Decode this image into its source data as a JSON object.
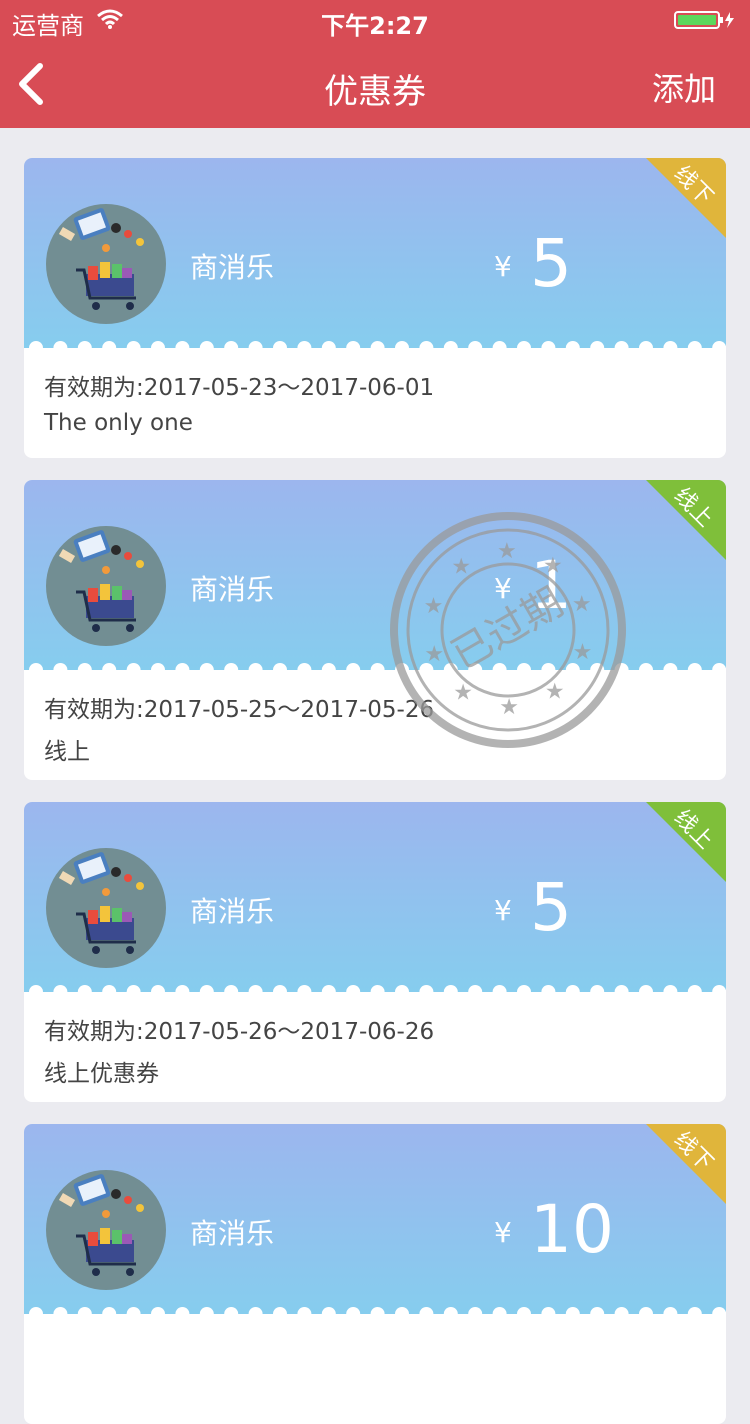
{
  "status": {
    "carrier": "运营商",
    "time": "下午2:27"
  },
  "nav": {
    "title": "优惠券",
    "add_label": "添加",
    "accent": "#d84c55"
  },
  "coupons": [
    {
      "brand": "商消乐",
      "currency": "¥",
      "amount": "5",
      "tag": "线下",
      "tag_color": "#e0b53b",
      "validity": "有效期为:2017-05-23～2017-06-01",
      "desc": "The only one",
      "expired": false
    },
    {
      "brand": "商消乐",
      "currency": "¥",
      "amount": "1",
      "tag": "线上",
      "tag_color": "#7fbf3a",
      "validity": "有效期为:2017-05-25～2017-05-26",
      "desc": "线上",
      "expired": true,
      "stamp": "已过期"
    },
    {
      "brand": "商消乐",
      "currency": "¥",
      "amount": "5",
      "tag": "线上",
      "tag_color": "#7fbf3a",
      "validity": "有效期为:2017-05-26～2017-06-26",
      "desc": "线上优惠券",
      "expired": false
    },
    {
      "brand": "商消乐",
      "currency": "¥",
      "amount": "10",
      "tag": "线下",
      "tag_color": "#e0b53b",
      "validity": "",
      "desc": "",
      "expired": false
    }
  ]
}
